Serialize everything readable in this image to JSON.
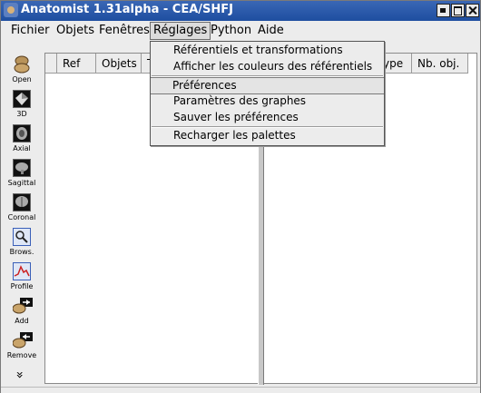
{
  "window": {
    "title": "Anatomist 1.31alpha - CEA/SHFJ"
  },
  "menubar": [
    "Fichier",
    "Objets",
    "Fenêtres",
    "Réglages",
    "Python",
    "Aide"
  ],
  "toolbar": [
    "Open",
    "3D",
    "Axial",
    "Sagittal",
    "Coronal",
    "Brows.",
    "Profile",
    "Add",
    "Remove"
  ],
  "toolbar_more": "»",
  "table": {
    "headers": [
      "Ref",
      "Objets",
      "T",
      "ype",
      "Nb. obj."
    ]
  },
  "dropdown": {
    "items": [
      "Référentiels et transformations",
      "Afficher les couleurs des référentiels",
      "Préférences",
      "Paramètres des graphes",
      "Sauver les préférences",
      "Recharger les palettes"
    ]
  }
}
